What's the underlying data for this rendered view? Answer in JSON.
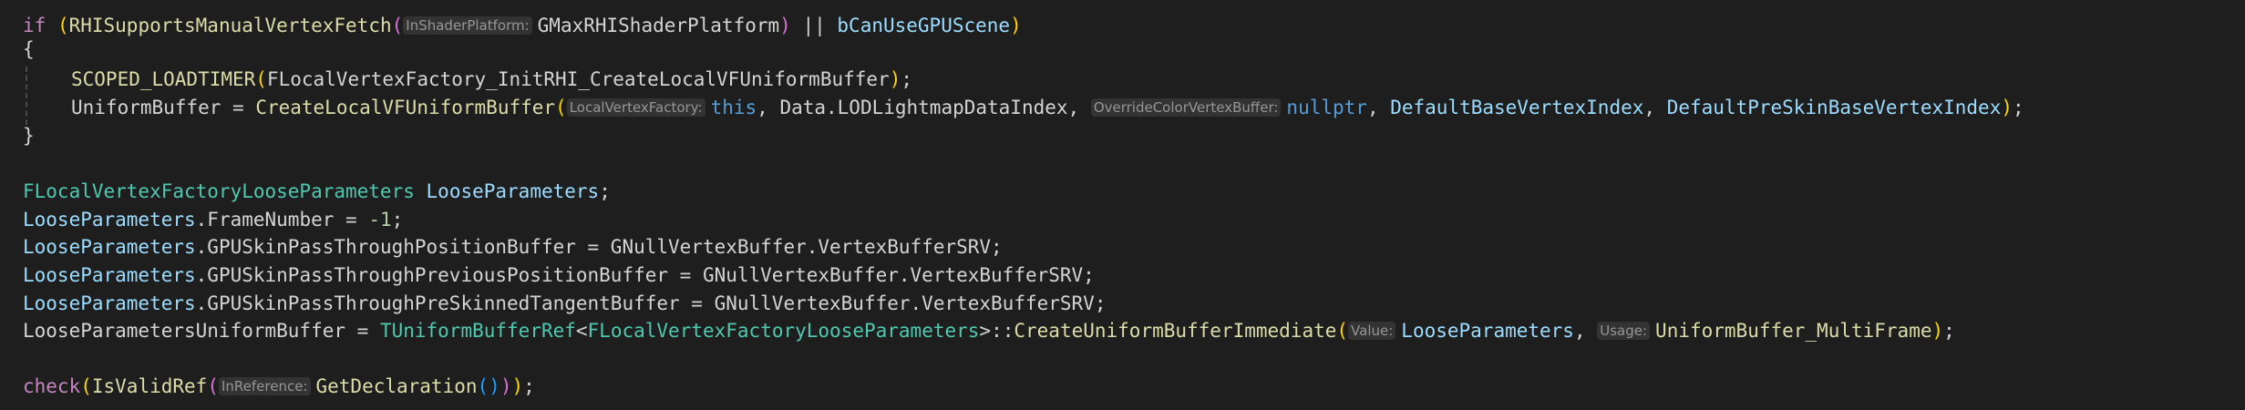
{
  "code": {
    "l1": {
      "kw_if": "if",
      "paren_open": " (",
      "fn_supports": "RHISupportsManualVertexFetch",
      "paren_call": "(",
      "hint_platform": "InShaderPlatform:",
      "arg_platform": "GMaxRHIShaderPlatform",
      "paren_close": ")",
      "op_or": " || ",
      "var_gpuscene": "bCanUseGPUScene",
      "paren_end": ")"
    },
    "l2": {
      "brace": "{"
    },
    "l3": {
      "macro": "SCOPED_LOADTIMER",
      "paren_open": "(",
      "arg": "FLocalVertexFactory_InitRHI_CreateLocalVFUniformBuffer",
      "paren_close": ")",
      "semi": ";"
    },
    "l4": {
      "lhs": "UniformBuffer",
      "assign": " = ",
      "fn": "CreateLocalVFUniformBuffer",
      "paren_open": "(",
      "hint_factory": "LocalVertexFactory:",
      "arg_this": "this",
      "comma1": ", ",
      "arg_data": "Data.LODLightmapDataIndex",
      "comma2": ", ",
      "hint_override": "OverrideColorVertexBuffer:",
      "arg_null": "nullptr",
      "comma3": ", ",
      "arg_base": "DefaultBaseVertexIndex",
      "comma4": ", ",
      "arg_preskin": "DefaultPreSkinBaseVertexIndex",
      "paren_close": ")",
      "semi": ";"
    },
    "l5": {
      "brace": "}"
    },
    "l7": {
      "type": "FLocalVertexFactoryLooseParameters",
      "space": " ",
      "var": "LooseParameters",
      "semi": ";"
    },
    "l8": {
      "var": "LooseParameters",
      "rest": ".FrameNumber = ",
      "num": "-1",
      "semi": ";"
    },
    "l9": {
      "var": "LooseParameters",
      "rest": ".GPUSkinPassThroughPositionBuffer = GNullVertexBuffer.VertexBufferSRV;"
    },
    "l10": {
      "var": "LooseParameters",
      "rest": ".GPUSkinPassThroughPreviousPositionBuffer = GNullVertexBuffer.VertexBufferSRV;"
    },
    "l11": {
      "var": "LooseParameters",
      "rest": ".GPUSkinPassThroughPreSkinnedTangentBuffer = GNullVertexBuffer.VertexBufferSRV;"
    },
    "l12": {
      "lhs": "LooseParametersUniformBuffer",
      "assign": " = ",
      "type_ref": "TUniformBufferRef",
      "lt": "<",
      "type_arg": "FLocalVertexFactoryLooseParameters",
      "gt": ">",
      "scope": "::",
      "fn": "CreateUniformBufferImmediate",
      "paren_open": "(",
      "hint_value": "Value:",
      "arg_loose": "LooseParameters",
      "comma": ", ",
      "hint_usage": "Usage:",
      "arg_usage": "UniformBuffer_MultiFrame",
      "paren_close": ")",
      "semi": ";"
    },
    "l14": {
      "fn_check": "check",
      "paren1": "(",
      "fn_isvalid": "IsValidRef",
      "paren2": "(",
      "hint_ref": "InReference:",
      "fn_getdecl": "GetDeclaration",
      "paren3": "()",
      "paren2c": ")",
      "paren1c": ")",
      "semi": ";"
    }
  }
}
